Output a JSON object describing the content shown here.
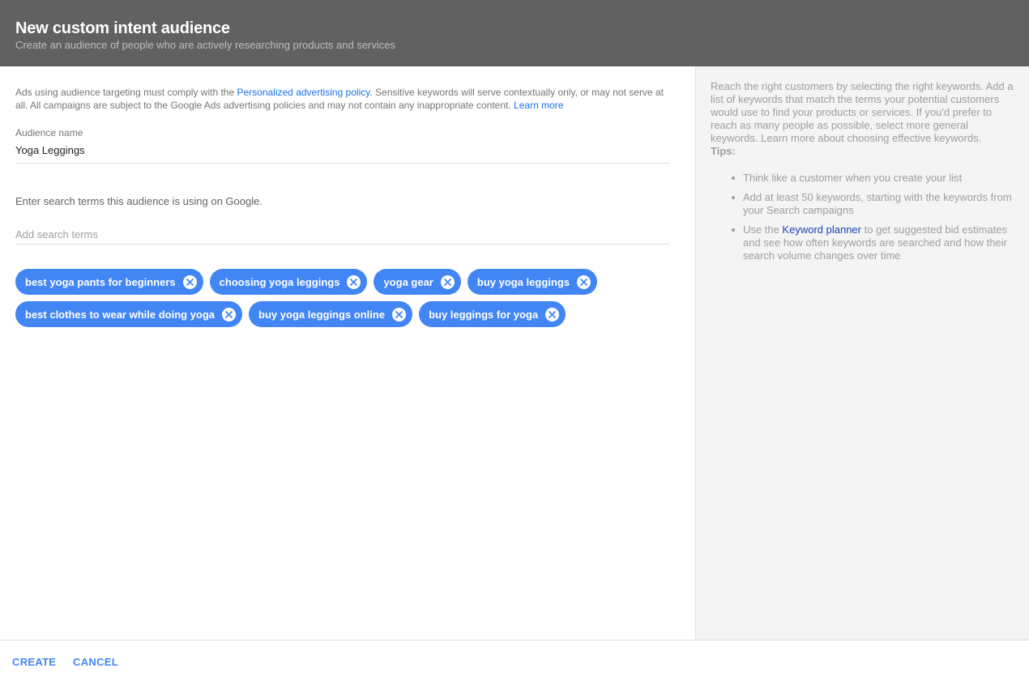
{
  "header": {
    "title": "New custom intent audience",
    "subtitle": "Create an audience of people who are actively researching products and services"
  },
  "main": {
    "notice": {
      "before": "Ads using audience targeting must comply with the ",
      "link1": "Personalized advertising policy",
      "middle": ". Sensitive keywords will serve contextually only, or may not serve at all. All campaigns are subject to the Google Ads advertising policies and may not contain any inappropriate content. ",
      "link2": "Learn more"
    },
    "audience_name_label": "Audience name",
    "audience_name_value": "Yoga Leggings",
    "instruction": "Enter search terms this audience is using on Google.",
    "search_placeholder": "Add search terms",
    "chips": [
      "best yoga pants for beginners",
      "choosing yoga leggings",
      "yoga gear",
      "buy yoga leggings",
      "best clothes to wear while doing yoga",
      "buy yoga leggings online",
      "buy leggings for yoga"
    ]
  },
  "side": {
    "intro": "Reach the right customers by selecting the right keywords. Add a list of keywords that match the terms your potential customers would use to find your products or services. If you'd prefer to reach as many people as possible, select more general keywords. Learn more about choosing effective keywords.",
    "tips_title": "Tips:",
    "tip1": "Think like a customer when you create your list",
    "tip2": "Add at least 50 keywords, starting with the keywords from your Search campaigns",
    "tip3_before": "Use the ",
    "tip3_link": "Keyword planner",
    "tip3_after": " to get suggested bid estimates and see how often keywords are searched and how their search volume changes over time"
  },
  "footer": {
    "create_label": "CREATE",
    "cancel_label": "CANCEL"
  },
  "colors": {
    "header_bg": "#616161",
    "chip_bg": "#4285f4",
    "accent": "#4285f4",
    "side_bg": "#f4f4f4"
  }
}
